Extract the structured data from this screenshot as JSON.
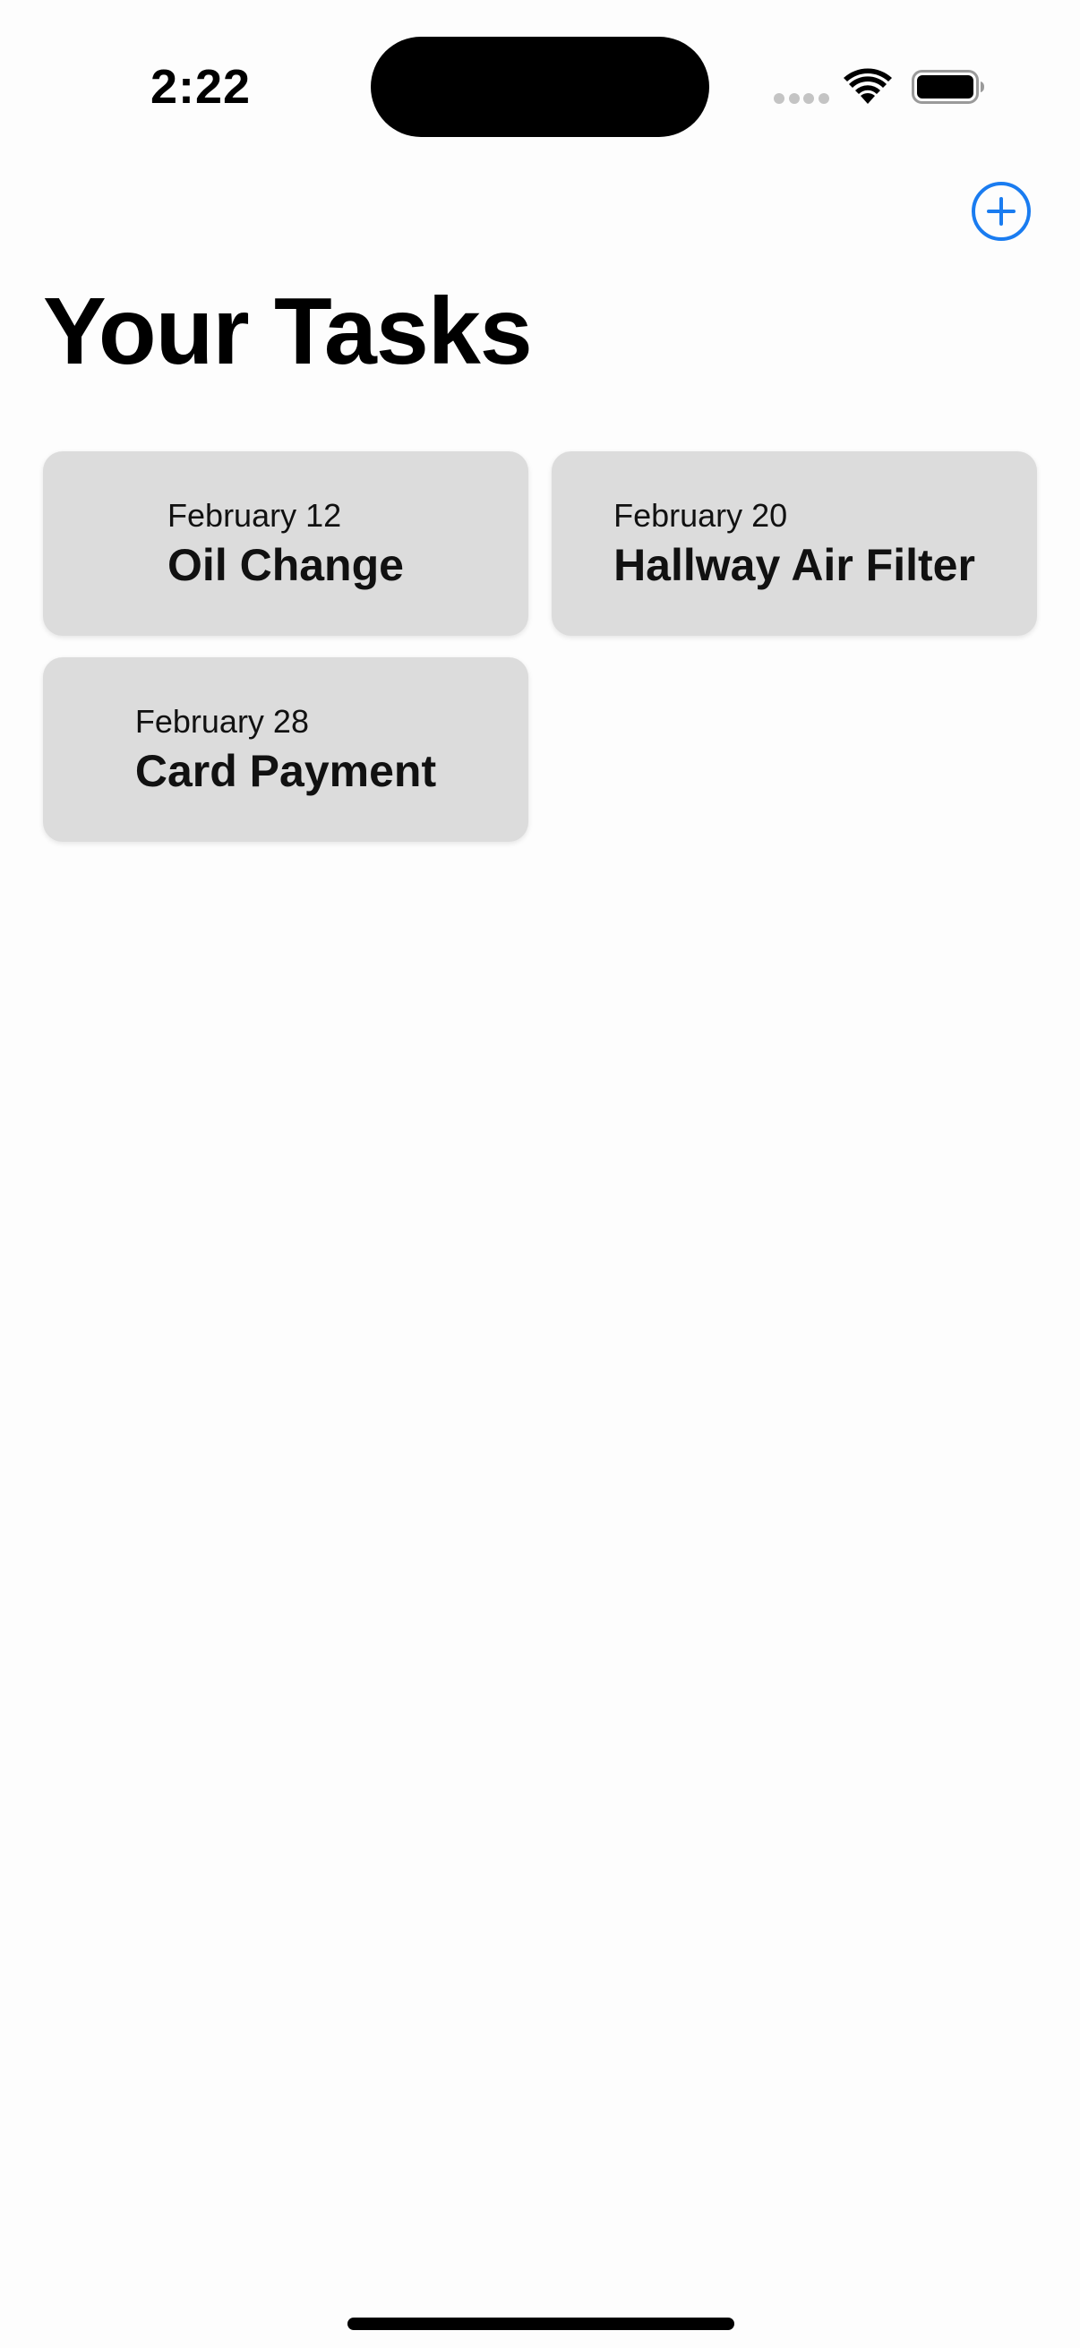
{
  "status_bar": {
    "time": "2:22"
  },
  "header": {
    "add_icon": "plus-circle-icon",
    "accent_color": "#1a7cf0"
  },
  "page": {
    "title": "Your Tasks"
  },
  "tasks": [
    {
      "date": "February 12",
      "name": "Oil Change"
    },
    {
      "date": "February 20",
      "name": "Hallway Air Filter"
    },
    {
      "date": "February 28",
      "name": "Card Payment"
    }
  ]
}
